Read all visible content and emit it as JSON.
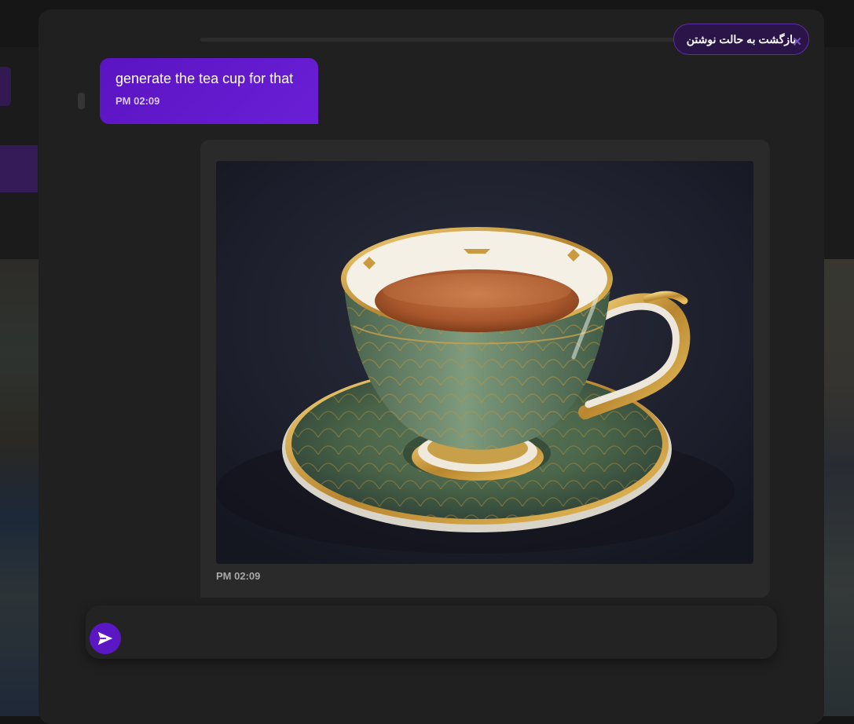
{
  "header": {
    "back_to_edit_label": "بازگشت به حالت نوشتن",
    "close_glyph": "✕"
  },
  "messages": [
    {
      "role": "user",
      "text": "generate the tea cup for that",
      "time": "PM 02:09"
    },
    {
      "role": "assistant",
      "image": "green-gold-teacup-on-saucer",
      "time": "PM 02:09"
    }
  ],
  "composer": {
    "placeholder": "",
    "value": "",
    "send_icon": "send-icon"
  },
  "colors": {
    "accent": "#5b17c4",
    "panel": "#202020",
    "card": "#2a2a2a",
    "bubble": "#6119cc"
  }
}
